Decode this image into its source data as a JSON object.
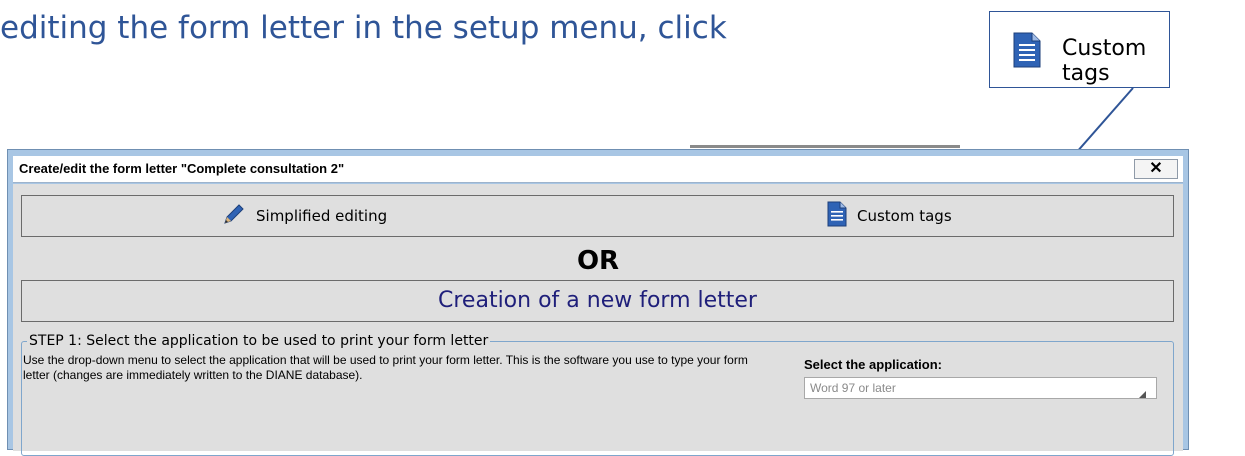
{
  "instruction": {
    "text": "editing the form letter in the setup menu, click"
  },
  "callout": {
    "label": "Custom tags",
    "icon": "document-icon"
  },
  "window": {
    "title": "Create/edit the form letter \"Complete consultation 2\"",
    "close_label": "✕",
    "simplified_editing": {
      "label": "Simplified editing",
      "icon": "pencil-icon"
    },
    "custom_tags": {
      "label": "Custom tags",
      "icon": "document-icon"
    },
    "or_label": "OR",
    "new_form_letter": "Creation of a new form letter",
    "step1": {
      "legend": "STEP 1: Select the application to be used to print your form letter",
      "description": "Use the drop-down menu to select the application that will be used to print your form letter. This is the software you use to type your form letter (changes are immediately written to the DIANE database).",
      "select_label": "Select the application:",
      "select_value": "Word 97 or later"
    }
  },
  "colors": {
    "instruction": "#2f5597",
    "window_frame": "#a8c6e4",
    "panel": "#dfdfdf",
    "doc_icon": "#2f63b5",
    "new_letter_text": "#1f1f7a"
  }
}
